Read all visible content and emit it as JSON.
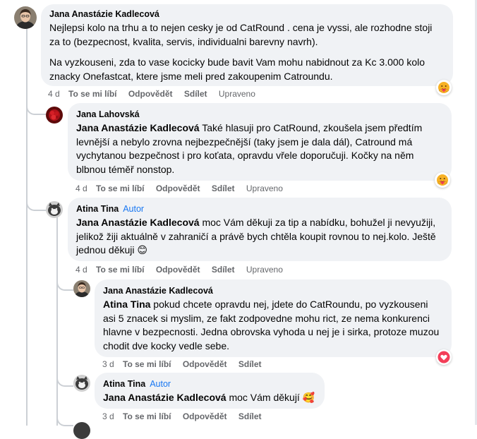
{
  "comments": [
    {
      "author": "Jana Anastázie Kadlecová",
      "paragraphs": [
        "Nejlepsi kolo na trhu a to nejen cesky je od CatRound . cena je vyssi, ale rozhodne stoji za to (bezpecnost, kvalita, servis, individualni barevny navrh).",
        "Na vyzkouseni, zda to vase kocicky bude bavit Vam mohu nabidnout za Kc 3.000 kolo znacky Onefastcat, ktere jsme meli pred zakoupenim Catroundu."
      ],
      "time": "4 d",
      "like": "To se mi líbí",
      "reply": "Odpovědět",
      "share": "Sdílet",
      "edited": "Upraveno",
      "reaction_icon": "care-emoji-icon"
    },
    {
      "author": "Jana Lahovská",
      "mention": "Jana Anastázie Kadlecová",
      "text": " Také hlasuji pro CatRound, zkoušela jsem předtím levnější a nebylo zrovna nejbezpečnější (taky jsem je dala dál), Catround má vychytanou bezpečnost i pro koťata, opravdu vřele doporučuji. Kočky na něm blbnou téměř nonstop.",
      "time": "4 d",
      "like": "To se mi líbí",
      "reply": "Odpovědět",
      "share": "Sdílet",
      "edited": "Upraveno",
      "reaction_icon": "care-emoji-icon"
    },
    {
      "author": "Atina Tina",
      "badge": "Autor",
      "mention": "Jana Anastázie Kadlecová",
      "text": " moc Vám děkuji za tip a nabídku, bohužel ji nevyužiji, jelikož žiji aktuálně v zahraničí a právě bych chtěla koupit rovnou to nej.kolo. Ještě jednou děkuji ",
      "emoji": "😊",
      "time": "4 d",
      "like": "To se mi líbí",
      "reply": "Odpovědět",
      "share": "Sdílet",
      "edited": "Upraveno"
    },
    {
      "author": "Jana Anastázie Kadlecová",
      "mention": "Atina Tina",
      "text": " pokud chcete opravdu nej, jdete do CatRoundu, po vyzkouseni asi 5 znacek si myslim, ze fakt zodpovedne mohu rict, ze nema konkurenci hlavne v bezpecnosti. Jedna obrovska vyhoda u nej je i sirka, protoze muzou chodit dve kocky vedle sebe.",
      "time": "3 d",
      "like": "To se mi líbí",
      "reply": "Odpovědět",
      "share": "Sdílet",
      "reaction_icon": "love-heart-icon"
    },
    {
      "author": "Atina Tina",
      "badge": "Autor",
      "mention": "Jana Anastázie Kadlecová",
      "text": " moc Vám děkují ",
      "emoji": "🥰",
      "time": "3 d",
      "like": "To se mi líbí",
      "reply": "Odpovědět",
      "share": "Sdílet"
    }
  ],
  "colors": {
    "bubble": "#f0f2f5",
    "secondary_text": "#65676b",
    "author_badge": "#1877f2",
    "love_red": "#f33e58",
    "care_yellow": "#f7b125"
  }
}
